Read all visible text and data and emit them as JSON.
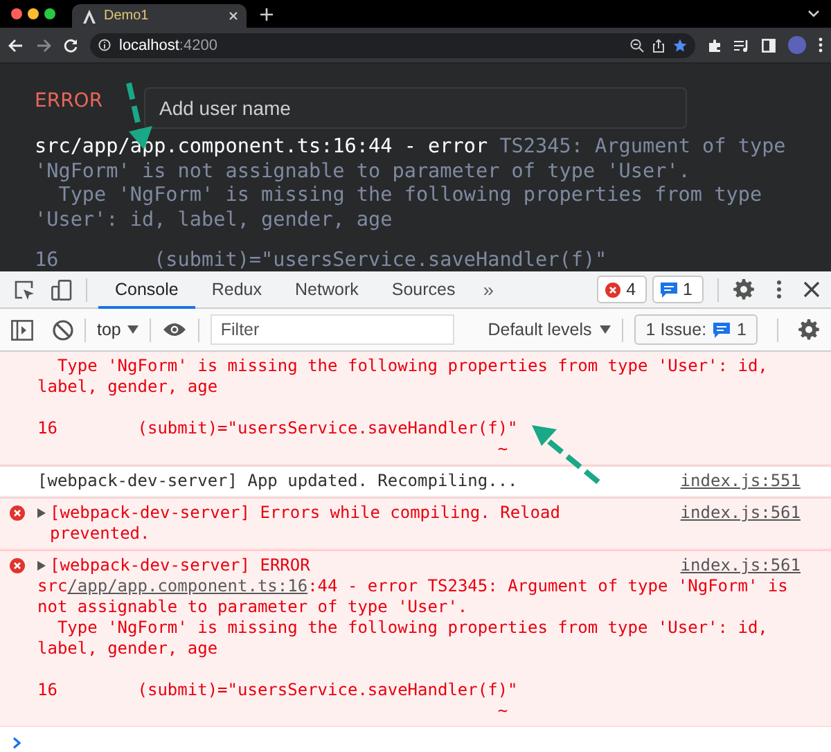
{
  "browser": {
    "tab": {
      "title": "Demo1",
      "selected": true
    },
    "url": {
      "host": "localhost",
      "port": ":4200"
    }
  },
  "page": {
    "form": {
      "name_placeholder": "Add user name"
    },
    "overlay": {
      "heading": "ERROR",
      "location": "src/app/app.component.ts:16:44 - error",
      "message": "TS2345: Argument of type 'NgForm' is not assignable to parameter of type 'User'.\n  Type 'NgForm' is missing the following properties from type 'User': id, label, gender, age",
      "code_line": "16        (submit)=\"usersService.saveHandler(f)\""
    }
  },
  "devtools": {
    "tabs": [
      {
        "label": "Console",
        "selected": true
      },
      {
        "label": "Redux",
        "selected": false
      },
      {
        "label": "Network",
        "selected": false
      },
      {
        "label": "Sources",
        "selected": false
      }
    ],
    "more": "»",
    "error_count": "4",
    "message_count": "1",
    "context": "top",
    "filter_placeholder": "Filter",
    "levels": "Default levels",
    "issues": {
      "label": "1 Issue:",
      "count": "1"
    }
  },
  "console": {
    "messages": [
      {
        "kind": "error",
        "continued": true,
        "expandable": false,
        "blocks": [
          {
            "kind": "text",
            "parts": [
              {
                "kind": "text",
                "text": "  Type 'NgForm' is missing the following properties from type 'User': id, label, gender, age"
              }
            ]
          },
          {
            "kind": "code",
            "text": "16        (submit)=\"usersService.saveHandler(f)\"\n                                              ~"
          }
        ]
      },
      {
        "kind": "info",
        "continued": false,
        "expandable": false,
        "source": "index.js:551",
        "blocks": [
          {
            "kind": "text",
            "parts": [
              {
                "kind": "text",
                "text": "[webpack-dev-server] App updated. Recompiling..."
              }
            ]
          }
        ]
      },
      {
        "kind": "error",
        "continued": false,
        "expandable": true,
        "source": "index.js:561",
        "blocks": [
          {
            "kind": "text",
            "parts": [
              {
                "kind": "text",
                "text": "[webpack-dev-server] Errors while compiling. Reload prevented."
              }
            ]
          }
        ]
      },
      {
        "kind": "error",
        "continued": false,
        "expandable": true,
        "source": "index.js:561",
        "blocks": [
          {
            "kind": "text",
            "parts": [
              {
                "kind": "text",
                "text": "[webpack-dev-server] ERROR"
              }
            ]
          },
          {
            "kind": "text",
            "parts": [
              {
                "kind": "text",
                "text": "src"
              },
              {
                "kind": "link",
                "text": "/app/app.component.ts:16"
              },
              {
                "kind": "text",
                "text": ":44 - error TS2345: Argument of type 'NgForm' is not assignable to parameter of type 'User'.\n  Type 'NgForm' is missing the following properties from type 'User': id, label, gender, age"
              }
            ]
          },
          {
            "kind": "code",
            "text": "16        (submit)=\"usersService.saveHandler(f)\"\n                                              ~"
          }
        ]
      }
    ]
  }
}
